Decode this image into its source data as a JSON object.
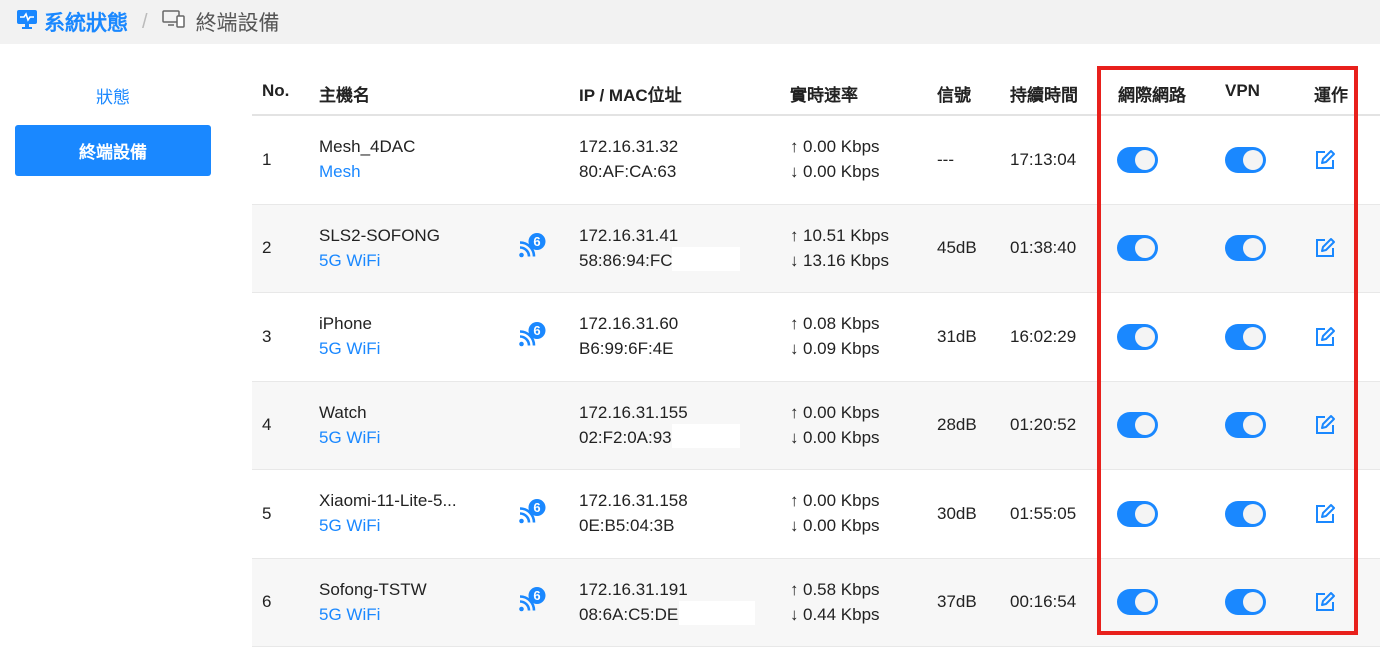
{
  "breadcrumb": {
    "home_label": "系統狀態",
    "separator": "/",
    "current_label": "終端設備"
  },
  "sidebar": {
    "items": [
      {
        "label": "狀態",
        "active": false
      },
      {
        "label": "終端設備",
        "active": true
      }
    ]
  },
  "table": {
    "headers": {
      "no": "No.",
      "hostname": "主機名",
      "ip_mac": "IP / MAC位址",
      "rate": "實時速率",
      "signal": "信號",
      "duration": "持續時間",
      "internet": "網際網路",
      "vpn": "VPN",
      "action": "運作"
    },
    "rows": [
      {
        "no": "1",
        "hostname": "Mesh_4DAC",
        "conn": "Mesh",
        "wifi6": false,
        "ip": "172.16.31.32",
        "mac": "80:AF:CA:63",
        "up": "0.00 Kbps",
        "down": "0.00 Kbps",
        "signal": "---",
        "duration": "17:13:04",
        "internet": true,
        "vpn": true
      },
      {
        "no": "2",
        "hostname": "SLS2-SOFONG",
        "conn": "5G WiFi",
        "wifi6": true,
        "ip": "172.16.31.41",
        "mac": "58:86:94:FC",
        "up": "10.51 Kbps",
        "down": "13.16 Kbps",
        "signal": "45dB",
        "duration": "01:38:40",
        "internet": true,
        "vpn": true
      },
      {
        "no": "3",
        "hostname": "iPhone",
        "conn": "5G WiFi",
        "wifi6": true,
        "ip": "172.16.31.60",
        "mac": "B6:99:6F:4E",
        "up": "0.08 Kbps",
        "down": "0.09 Kbps",
        "signal": "31dB",
        "duration": "16:02:29",
        "internet": true,
        "vpn": true
      },
      {
        "no": "4",
        "hostname": "Watch",
        "conn": "5G WiFi",
        "wifi6": false,
        "ip": "172.16.31.155",
        "mac": "02:F2:0A:93",
        "up": "0.00 Kbps",
        "down": "0.00 Kbps",
        "signal": "28dB",
        "duration": "01:20:52",
        "internet": true,
        "vpn": true
      },
      {
        "no": "5",
        "hostname": "Xiaomi-11-Lite-5...",
        "conn": "5G WiFi",
        "wifi6": true,
        "ip": "172.16.31.158",
        "mac": "0E:B5:04:3B",
        "up": "0.00 Kbps",
        "down": "0.00 Kbps",
        "signal": "30dB",
        "duration": "01:55:05",
        "internet": true,
        "vpn": true
      },
      {
        "no": "6",
        "hostname": "Sofong-TSTW",
        "conn": "5G WiFi",
        "wifi6": true,
        "ip": "172.16.31.191",
        "mac": "08:6A:C5:DE",
        "up": "0.58 Kbps",
        "down": "0.44 Kbps",
        "signal": "37dB",
        "duration": "00:16:54",
        "internet": true,
        "vpn": true
      }
    ]
  },
  "colors": {
    "accent": "#1a88ff",
    "highlight_box": "#e8201c"
  },
  "icons": {
    "home": "monitor-pulse-icon",
    "devices": "devices-icon",
    "wifi6": "wifi6-icon",
    "edit": "edit-icon",
    "up": "arrow-up-icon",
    "down": "arrow-down-icon"
  }
}
